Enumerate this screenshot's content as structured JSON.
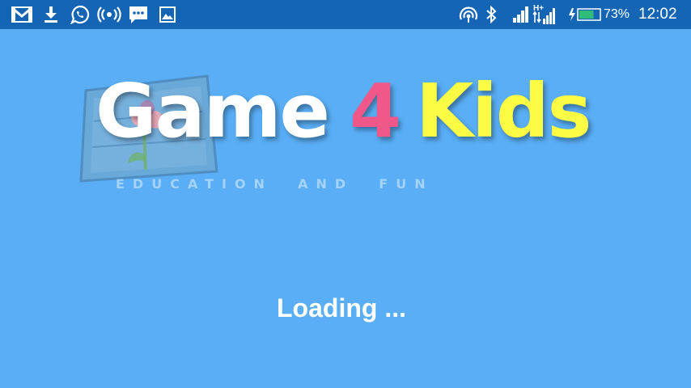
{
  "status_bar": {
    "left_icons": [
      "gmail-icon",
      "download-icon",
      "whatsapp-icon",
      "hotspot-icon",
      "message-icon",
      "image-icon"
    ],
    "right_icons": [
      "nfc-icon",
      "bluetooth-icon",
      "signal-icon",
      "hplus-data-icon",
      "battery-charging-icon"
    ],
    "network_label": "H+",
    "battery_level": "73%",
    "battery_fill_fraction": 0.73,
    "time": "12:02",
    "background_color": "#1565b5"
  },
  "splash": {
    "logo": {
      "word_game": "Game",
      "word_four": "4",
      "word_kids": "Kids",
      "colors": {
        "game": "#ffffff",
        "four": "#f0588a",
        "kids": "#fdfc44"
      }
    },
    "tagline": "EDUCATION  AND  FUN",
    "loading_text": "Loading ...",
    "background_color": "#59aef5"
  }
}
